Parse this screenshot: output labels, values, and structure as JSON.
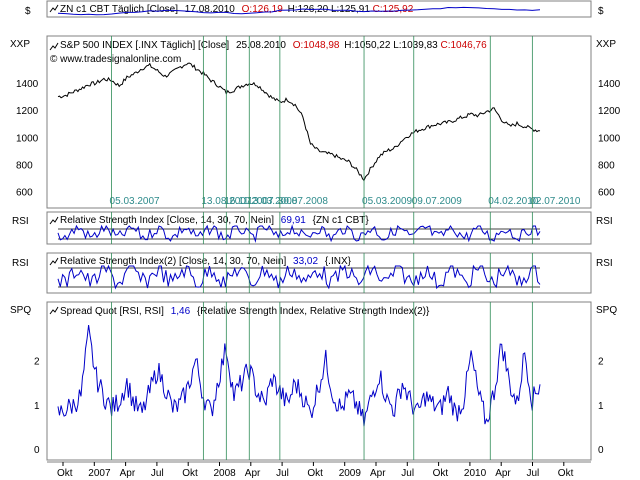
{
  "colors": {
    "frame": "#808080",
    "background": "#ffffff",
    "series": "#0000c8",
    "black_series": "#000000",
    "vline": "#2e8b57",
    "hline": "#000000",
    "red": "#cc0000",
    "teal_text": "#2e8b8b"
  },
  "panels": {
    "zn": {
      "left_label": "$",
      "right_label": "$",
      "icon": "line-chart-icon",
      "header_prefix": "ZN c1 CBT Täglich [Close]",
      "date": "17.08.2010",
      "open": "O:126,19",
      "high": "H:126,20",
      "low": "L:125,91",
      "close": "C:125,92"
    },
    "spx": {
      "left_label": "XXP",
      "right_label": "XXP",
      "icon": "line-chart-icon",
      "header_prefix": "S&P 500 INDEX [.INX Täglich] [Close]",
      "date": "25.08.2010",
      "open": "O:1048,98",
      "high": "H:1050,22",
      "low": "L:1039,83",
      "close": "C:1046,76",
      "copyright": "© www.tradesignalonline.com",
      "y_ticks": [
        "1400",
        "1200",
        "1000",
        "800",
        "600"
      ],
      "date_labels": [
        "05.03.2007",
        "13.08.2007",
        "16.11.2007",
        "13.03.2008",
        "30.07.2008",
        "05.03.2009",
        "09.07.2009",
        "04.02.2010",
        "02.07.2010"
      ]
    },
    "rsi1": {
      "left_label": "RSI",
      "right_label": "RSI",
      "icon": "line-chart-icon",
      "text": "Relative Strength Index [Close, 14, 30, 70, Nein]",
      "value": "69,91",
      "source": "{ZN c1 CBT}"
    },
    "rsi2": {
      "left_label": "RSI",
      "right_label": "RSI",
      "icon": "line-chart-icon",
      "text": "Relative Strength Index(2) [Close, 14, 30, 70, Nein]",
      "value": "33,02",
      "source": "{.INX}"
    },
    "spq": {
      "left_label": "SPQ",
      "right_label": "SPQ",
      "icon": "line-chart-icon",
      "text": "Spread Quot [RSI, RSI]",
      "value": "1,46",
      "source": "{Relative Strength Index, Relative Strength Index(2)}",
      "y_ticks": [
        "2",
        "1",
        "0"
      ]
    }
  },
  "time_axis": [
    "Okt",
    "2007",
    "Apr",
    "Jul",
    "Okt",
    "2008",
    "Apr",
    "Jul",
    "Okt",
    "2009",
    "Apr",
    "Jul",
    "Okt",
    "2010",
    "Apr",
    "Jul",
    "Okt"
  ],
  "chart_data": {
    "type": "line",
    "series": [
      {
        "name": "S&P 500 INDEX",
        "ylim": [
          500,
          1600
        ],
        "points": [
          [
            0,
            1300
          ],
          [
            2,
            1310
          ],
          [
            4,
            1335
          ],
          [
            6,
            1360
          ],
          [
            8,
            1390
          ],
          [
            10,
            1400
          ],
          [
            12,
            1430
          ],
          [
            14,
            1420
          ],
          [
            16,
            1380
          ],
          [
            18,
            1440
          ],
          [
            20,
            1470
          ],
          [
            22,
            1510
          ],
          [
            24,
            1530
          ],
          [
            26,
            1490
          ],
          [
            28,
            1450
          ],
          [
            30,
            1480
          ],
          [
            32,
            1520
          ],
          [
            34,
            1550
          ],
          [
            36,
            1510
          ],
          [
            38,
            1470
          ],
          [
            40,
            1420
          ],
          [
            42,
            1380
          ],
          [
            44,
            1330
          ],
          [
            46,
            1350
          ],
          [
            48,
            1380
          ],
          [
            50,
            1400
          ],
          [
            52,
            1390
          ],
          [
            54,
            1340
          ],
          [
            56,
            1290
          ],
          [
            58,
            1260
          ],
          [
            60,
            1280
          ],
          [
            62,
            1240
          ],
          [
            64,
            1150
          ],
          [
            66,
            950
          ],
          [
            68,
            900
          ],
          [
            70,
            880
          ],
          [
            72,
            870
          ],
          [
            74,
            840
          ],
          [
            76,
            820
          ],
          [
            78,
            760
          ],
          [
            80,
            690
          ],
          [
            82,
            780
          ],
          [
            84,
            860
          ],
          [
            86,
            900
          ],
          [
            88,
            920
          ],
          [
            90,
            980
          ],
          [
            92,
            1020
          ],
          [
            94,
            1050
          ],
          [
            96,
            1070
          ],
          [
            98,
            1090
          ],
          [
            100,
            1100
          ],
          [
            102,
            1110
          ],
          [
            104,
            1130
          ],
          [
            106,
            1150
          ],
          [
            108,
            1170
          ],
          [
            110,
            1160
          ],
          [
            112,
            1190
          ],
          [
            114,
            1210
          ],
          [
            116,
            1130
          ],
          [
            118,
            1080
          ],
          [
            120,
            1100
          ],
          [
            122,
            1080
          ],
          [
            124,
            1060
          ],
          [
            126,
            1047
          ]
        ]
      },
      {
        "name": "Spread Quot",
        "ylim": [
          -0.2,
          3
        ],
        "points": [
          [
            0,
            0.8
          ],
          [
            2,
            0.9
          ],
          [
            4,
            1.0
          ],
          [
            6,
            1.2
          ],
          [
            8,
            2.6
          ],
          [
            10,
            1.6
          ],
          [
            12,
            1.2
          ],
          [
            14,
            0.9
          ],
          [
            16,
            1.1
          ],
          [
            18,
            1.5
          ],
          [
            20,
            1.0
          ],
          [
            22,
            0.8
          ],
          [
            24,
            1.3
          ],
          [
            26,
            1.8
          ],
          [
            28,
            1.4
          ],
          [
            30,
            0.9
          ],
          [
            32,
            1.0
          ],
          [
            34,
            1.4
          ],
          [
            36,
            2.0
          ],
          [
            38,
            1.2
          ],
          [
            40,
            0.8
          ],
          [
            42,
            1.6
          ],
          [
            44,
            2.3
          ],
          [
            46,
            1.2
          ],
          [
            48,
            1.5
          ],
          [
            50,
            1.8
          ],
          [
            52,
            1.3
          ],
          [
            54,
            1.0
          ],
          [
            56,
            1.6
          ],
          [
            58,
            1.3
          ],
          [
            60,
            1.0
          ],
          [
            62,
            1.5
          ],
          [
            64,
            1.2
          ],
          [
            66,
            0.8
          ],
          [
            68,
            1.4
          ],
          [
            70,
            2.0
          ],
          [
            72,
            1.2
          ],
          [
            74,
            0.9
          ],
          [
            76,
            1.2
          ],
          [
            78,
            1.0
          ],
          [
            80,
            0.6
          ],
          [
            82,
            1.2
          ],
          [
            84,
            1.7
          ],
          [
            86,
            1.1
          ],
          [
            88,
            0.9
          ],
          [
            90,
            1.5
          ],
          [
            92,
            1.1
          ],
          [
            94,
            0.8
          ],
          [
            96,
            1.2
          ],
          [
            98,
            1.0
          ],
          [
            100,
            0.9
          ],
          [
            102,
            1.3
          ],
          [
            104,
            0.8
          ],
          [
            106,
            1.1
          ],
          [
            108,
            2.1
          ],
          [
            110,
            1.2
          ],
          [
            112,
            0.6
          ],
          [
            114,
            1.3
          ],
          [
            116,
            2.4
          ],
          [
            118,
            1.5
          ],
          [
            120,
            1.0
          ],
          [
            122,
            2.2
          ],
          [
            124,
            1.1
          ],
          [
            126,
            1.46
          ]
        ]
      }
    ]
  }
}
